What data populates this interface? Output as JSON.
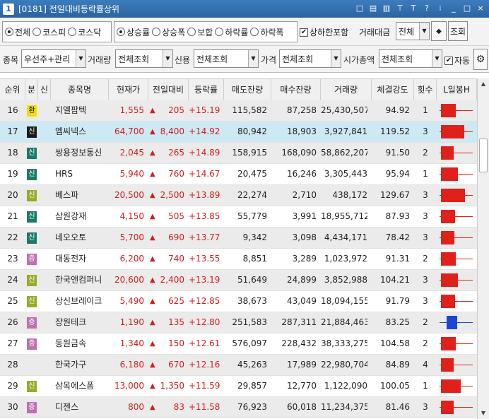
{
  "window": {
    "number": "1",
    "title": "[0181] 전일대비등락률상위",
    "icons": [
      "□",
      "▤",
      "▥",
      "⊤",
      "T",
      "?",
      "⁝",
      "_",
      "□",
      "×"
    ]
  },
  "filters": {
    "market": {
      "options": [
        "전체",
        "코스피",
        "코스닥"
      ],
      "selected": 0
    },
    "sort": {
      "options": [
        "상승률",
        "상승폭",
        "보합",
        "하락률",
        "하락폭"
      ],
      "selected": 0
    },
    "include_limit_label": "상하한포함",
    "include_limit_checked": true,
    "trade_value_label": "거래대금",
    "trade_value": "전체",
    "query_button": "조회",
    "stock_label": "종목",
    "stock_value": "우선주+관리",
    "volume_label": "거래량",
    "volume_value": "전체조회",
    "credit_label": "신용",
    "credit_value": "전체조회",
    "price_label": "가격",
    "price_value": "전체조회",
    "cap_label": "시가총액",
    "cap_value": "전체조회",
    "auto_label": "자동",
    "auto_checked": true
  },
  "columns": [
    "순위",
    "분",
    "신",
    "종목명",
    "현재가",
    "전일대비",
    "등락률",
    "매도잔량",
    "매수잔량",
    "거래량",
    "체결강도",
    "횟수",
    "L일봉H"
  ],
  "rows": [
    {
      "rank": "16",
      "badge": "환",
      "badge_color": "#f0e000",
      "badge_text": "#000",
      "name": "지엘팜텍",
      "price": "1,555",
      "diff": "205",
      "rate": "+15.19",
      "ask": "115,582",
      "bid": "87,258",
      "vol": "25,430,507",
      "strength": "94.92",
      "count": "1",
      "candle": "red",
      "body": 0.45
    },
    {
      "rank": "17",
      "badge": "신",
      "badge_color": "#1a1a1a",
      "badge_text": "#fff",
      "name": "엠씨넥스",
      "price": "64,700",
      "diff": "8,400",
      "rate": "+14.92",
      "ask": "80,942",
      "bid": "18,903",
      "vol": "3,927,841",
      "strength": "119.52",
      "count": "3",
      "candle": "red",
      "body": 0.7
    },
    {
      "rank": "18",
      "badge": "신",
      "badge_color": "#1a7a6a",
      "badge_text": "#fff",
      "name": "쌍용정보통신",
      "price": "2,045",
      "diff": "265",
      "rate": "+14.89",
      "ask": "158,915",
      "bid": "168,090",
      "vol": "58,862,207",
      "strength": "91.50",
      "count": "2",
      "candle": "red",
      "body": 0.38
    },
    {
      "rank": "19",
      "badge": "신",
      "badge_color": "#1a7a6a",
      "badge_text": "#fff",
      "name": "HRS",
      "price": "5,940",
      "diff": "760",
      "rate": "+14.67",
      "ask": "20,475",
      "bid": "16,246",
      "vol": "3,305,443",
      "strength": "95.94",
      "count": "1",
      "candle": "red",
      "body": 0.5
    },
    {
      "rank": "20",
      "badge": "신",
      "badge_color": "#9aaa2a",
      "badge_text": "#fff",
      "name": "베스파",
      "price": "20,500",
      "diff": "2,500",
      "rate": "+13.89",
      "ask": "22,274",
      "bid": "2,710",
      "vol": "438,172",
      "strength": "129.67",
      "count": "3",
      "candle": "red",
      "body": 0.72
    },
    {
      "rank": "21",
      "badge": "신",
      "badge_color": "#1a7a6a",
      "badge_text": "#fff",
      "name": "삼원강재",
      "price": "4,150",
      "diff": "505",
      "rate": "+13.85",
      "ask": "55,779",
      "bid": "3,991",
      "vol": "18,955,712",
      "strength": "87.93",
      "count": "3",
      "candle": "red",
      "body": 0.42
    },
    {
      "rank": "22",
      "badge": "신",
      "badge_color": "#1a7a6a",
      "badge_text": "#fff",
      "name": "네오오토",
      "price": "5,700",
      "diff": "690",
      "rate": "+13.77",
      "ask": "9,342",
      "bid": "3,098",
      "vol": "4,434,171",
      "strength": "78.42",
      "count": "3",
      "candle": "red",
      "body": 0.4
    },
    {
      "rank": "23",
      "badge": "증",
      "badge_color": "#c070b0",
      "badge_text": "#fff",
      "name": "대동전자",
      "price": "6,200",
      "diff": "740",
      "rate": "+13.55",
      "ask": "8,851",
      "bid": "3,289",
      "vol": "1,023,972",
      "strength": "91.31",
      "count": "2",
      "candle": "red",
      "body": 0.45
    },
    {
      "rank": "24",
      "badge": "신",
      "badge_color": "#9aaa2a",
      "badge_text": "#fff",
      "name": "한국앤컴퍼니",
      "price": "20,600",
      "diff": "2,400",
      "rate": "+13.19",
      "ask": "51,649",
      "bid": "24,899",
      "vol": "3,852,988",
      "strength": "104.21",
      "count": "3",
      "candle": "red",
      "body": 0.5
    },
    {
      "rank": "25",
      "badge": "신",
      "badge_color": "#9aaa2a",
      "badge_text": "#fff",
      "name": "상신브레이크",
      "price": "5,490",
      "diff": "625",
      "rate": "+12.85",
      "ask": "38,673",
      "bid": "43,049",
      "vol": "18,094,155",
      "strength": "91.79",
      "count": "3",
      "candle": "red",
      "body": 0.42
    },
    {
      "rank": "26",
      "badge": "증",
      "badge_color": "#c070b0",
      "badge_text": "#fff",
      "name": "장원테크",
      "price": "1,190",
      "diff": "135",
      "rate": "+12.80",
      "ask": "251,583",
      "bid": "287,311",
      "vol": "21,884,463",
      "strength": "83.25",
      "count": "2",
      "candle": "blue",
      "body": 0.32
    },
    {
      "rank": "27",
      "badge": "증",
      "badge_color": "#c070b0",
      "badge_text": "#fff",
      "name": "동원금속",
      "price": "1,340",
      "diff": "150",
      "rate": "+12.61",
      "ask": "576,097",
      "bid": "228,432",
      "vol": "38,333,275",
      "strength": "104.58",
      "count": "2",
      "candle": "red",
      "body": 0.45
    },
    {
      "rank": "28",
      "badge": "",
      "badge_color": "",
      "badge_text": "#000",
      "name": "한국가구",
      "price": "6,180",
      "diff": "670",
      "rate": "+12.16",
      "ask": "45,263",
      "bid": "17,989",
      "vol": "22,980,704",
      "strength": "84.89",
      "count": "4",
      "candle": "red",
      "body": 0.38
    },
    {
      "rank": "29",
      "badge": "신",
      "badge_color": "#9aaa2a",
      "badge_text": "#fff",
      "name": "삼목에스폼",
      "price": "13,000",
      "diff": "1,350",
      "rate": "+11.59",
      "ask": "29,857",
      "bid": "12,770",
      "vol": "1,122,090",
      "strength": "100.05",
      "count": "1",
      "candle": "red",
      "body": 0.6
    },
    {
      "rank": "30",
      "badge": "증",
      "badge_color": "#c070b0",
      "badge_text": "#fff",
      "name": "디젠스",
      "price": "800",
      "diff": "83",
      "rate": "+11.58",
      "ask": "76,923",
      "bid": "60,018",
      "vol": "11,234,375",
      "strength": "81.46",
      "count": "3",
      "candle": "red",
      "body": 0.38
    }
  ]
}
